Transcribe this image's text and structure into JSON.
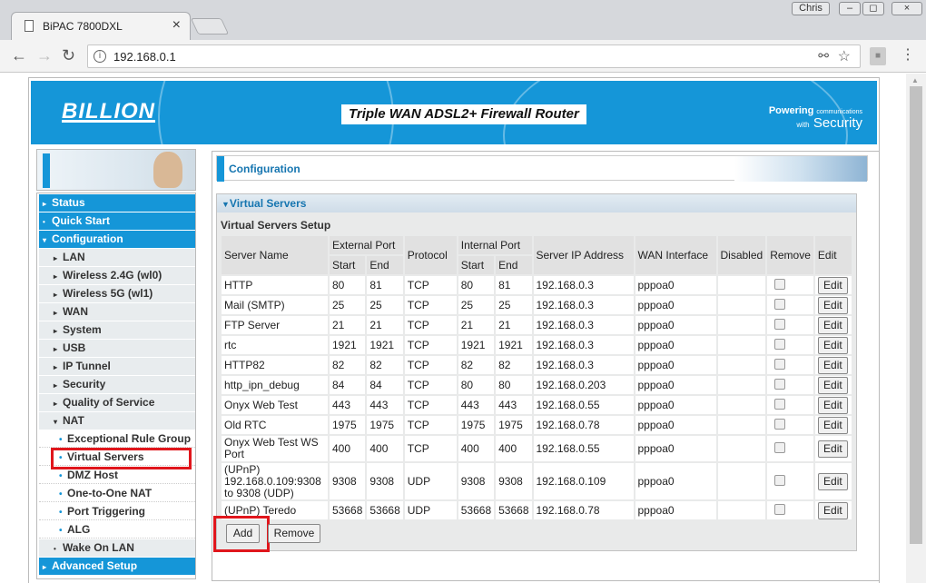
{
  "browser": {
    "tab_title": "BiPAC 7800DXL",
    "tab_close": "×",
    "user_label": "Chris",
    "url": "192.168.0.1",
    "win_buttons": [
      "‒",
      "◻",
      "×"
    ]
  },
  "header": {
    "logo": "BILLION",
    "title": "Triple WAN ADSL2+ Firewall Router",
    "tagline_main": "Powering",
    "tagline_small1": "communications",
    "tagline_small2": "with",
    "tagline_brand": "Security"
  },
  "sidebar": {
    "items": [
      {
        "label": "Status",
        "type": "blue",
        "arrow": "▸"
      },
      {
        "label": "Quick Start",
        "type": "blue",
        "arrow": "•"
      },
      {
        "label": "Configuration",
        "type": "blue",
        "arrow": "▾"
      },
      {
        "label": "LAN",
        "type": "sub",
        "arrow": "▸"
      },
      {
        "label": "Wireless 2.4G (wl0)",
        "type": "sub",
        "arrow": "▸"
      },
      {
        "label": "Wireless 5G (wl1)",
        "type": "sub",
        "arrow": "▸"
      },
      {
        "label": "WAN",
        "type": "sub",
        "arrow": "▸"
      },
      {
        "label": "System",
        "type": "sub",
        "arrow": "▸"
      },
      {
        "label": "USB",
        "type": "sub",
        "arrow": "▸"
      },
      {
        "label": "IP Tunnel",
        "type": "sub",
        "arrow": "▸"
      },
      {
        "label": "Security",
        "type": "sub",
        "arrow": "▸"
      },
      {
        "label": "Quality of Service",
        "type": "sub",
        "arrow": "▸"
      },
      {
        "label": "NAT",
        "type": "sub",
        "arrow": "▾"
      },
      {
        "label": "Exceptional Rule Group",
        "type": "sub2",
        "arrow": "•"
      },
      {
        "label": "Virtual Servers",
        "type": "sub2",
        "arrow": "•"
      },
      {
        "label": "DMZ Host",
        "type": "sub2",
        "arrow": "•"
      },
      {
        "label": "One-to-One NAT",
        "type": "sub2",
        "arrow": "•"
      },
      {
        "label": "Port Triggering",
        "type": "sub2",
        "arrow": "•"
      },
      {
        "label": "ALG",
        "type": "sub2",
        "arrow": "•"
      },
      {
        "label": "Wake On LAN",
        "type": "sub",
        "arrow": "•"
      },
      {
        "label": "Advanced Setup",
        "type": "blue",
        "arrow": "▸"
      }
    ]
  },
  "main": {
    "section_title": "Configuration",
    "panel_title": "Virtual Servers",
    "setup_title": "Virtual Servers Setup",
    "columns": {
      "server_name": "Server Name",
      "external_port": "External Port",
      "protocol": "Protocol",
      "internal_port": "Internal Port",
      "server_ip": "Server IP Address",
      "wan_interface": "WAN Interface",
      "disabled": "Disabled",
      "remove": "Remove",
      "edit": "Edit",
      "start": "Start",
      "end": "End"
    },
    "rows": [
      {
        "name": "HTTP",
        "ext_start": "80",
        "ext_end": "81",
        "protocol": "TCP",
        "int_start": "80",
        "int_end": "81",
        "ip": "192.168.0.3",
        "wan": "pppoa0"
      },
      {
        "name": "Mail (SMTP)",
        "ext_start": "25",
        "ext_end": "25",
        "protocol": "TCP",
        "int_start": "25",
        "int_end": "25",
        "ip": "192.168.0.3",
        "wan": "pppoa0"
      },
      {
        "name": "FTP Server",
        "ext_start": "21",
        "ext_end": "21",
        "protocol": "TCP",
        "int_start": "21",
        "int_end": "21",
        "ip": "192.168.0.3",
        "wan": "pppoa0"
      },
      {
        "name": "rtc",
        "ext_start": "1921",
        "ext_end": "1921",
        "protocol": "TCP",
        "int_start": "1921",
        "int_end": "1921",
        "ip": "192.168.0.3",
        "wan": "pppoa0"
      },
      {
        "name": "HTTP82",
        "ext_start": "82",
        "ext_end": "82",
        "protocol": "TCP",
        "int_start": "82",
        "int_end": "82",
        "ip": "192.168.0.3",
        "wan": "pppoa0"
      },
      {
        "name": "http_ipn_debug",
        "ext_start": "84",
        "ext_end": "84",
        "protocol": "TCP",
        "int_start": "80",
        "int_end": "80",
        "ip": "192.168.0.203",
        "wan": "pppoa0"
      },
      {
        "name": "Onyx Web Test",
        "ext_start": "443",
        "ext_end": "443",
        "protocol": "TCP",
        "int_start": "443",
        "int_end": "443",
        "ip": "192.168.0.55",
        "wan": "pppoa0"
      },
      {
        "name": "Old RTC",
        "ext_start": "1975",
        "ext_end": "1975",
        "protocol": "TCP",
        "int_start": "1975",
        "int_end": "1975",
        "ip": "192.168.0.78",
        "wan": "pppoa0"
      },
      {
        "name": "Onyx Web Test WS Port",
        "ext_start": "400",
        "ext_end": "400",
        "protocol": "TCP",
        "int_start": "400",
        "int_end": "400",
        "ip": "192.168.0.55",
        "wan": "pppoa0"
      },
      {
        "name": "(UPnP) 192.168.0.109:9308 to 9308 (UDP)",
        "ext_start": "9308",
        "ext_end": "9308",
        "protocol": "UDP",
        "int_start": "9308",
        "int_end": "9308",
        "ip": "192.168.0.109",
        "wan": "pppoa0"
      },
      {
        "name": "(UPnP) Teredo",
        "ext_start": "53668",
        "ext_end": "53668",
        "protocol": "UDP",
        "int_start": "53668",
        "int_end": "53668",
        "ip": "192.168.0.78",
        "wan": "pppoa0"
      }
    ],
    "edit_label": "Edit",
    "add_label": "Add",
    "remove_label": "Remove"
  },
  "colors": {
    "accent": "#1596d8",
    "highlight": "#e0161c"
  }
}
